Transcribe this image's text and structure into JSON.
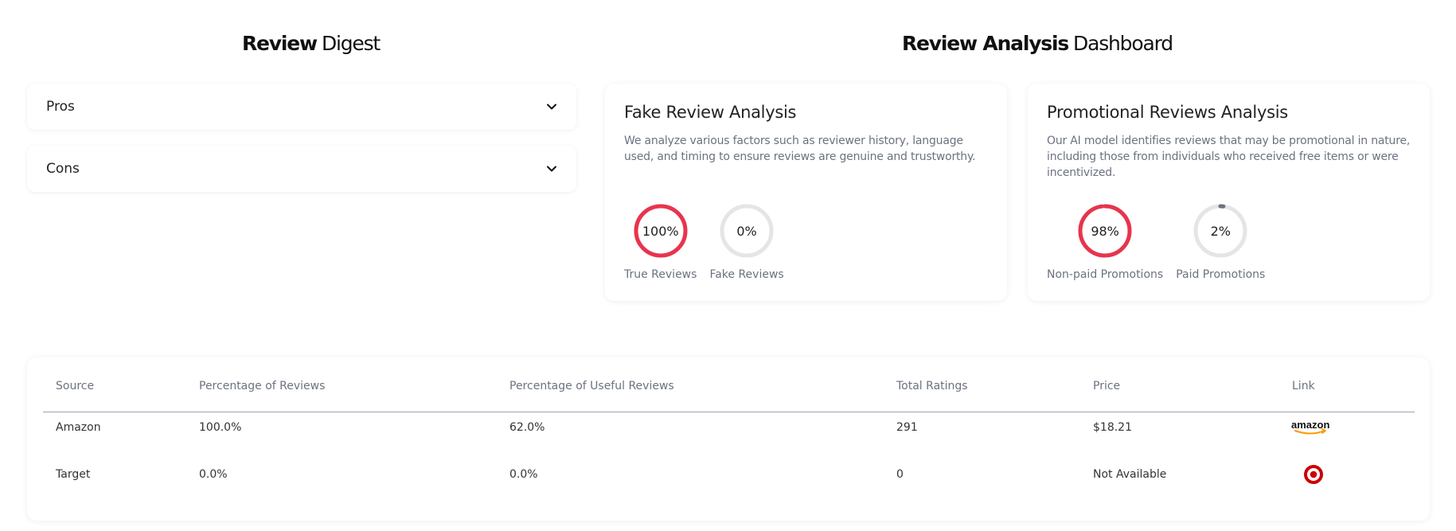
{
  "digest": {
    "title_bold": "Review",
    "title_light": "Digest",
    "sections": [
      {
        "label": "Pros"
      },
      {
        "label": "Cons"
      }
    ]
  },
  "dashboard": {
    "title_bold": "Review Analysis",
    "title_light": "Dashboard",
    "fake": {
      "title": "Fake Review Analysis",
      "description": "We analyze various factors such as reviewer history, language used, and timing to ensure reviews are genuine and trustworthy.",
      "rings": [
        {
          "value": "100%",
          "label": "True Reviews",
          "fraction": 1.0
        },
        {
          "value": "0%",
          "label": "Fake Reviews",
          "fraction": 0.0
        }
      ]
    },
    "promo": {
      "title": "Promotional Reviews Analysis",
      "description": "Our AI model identifies reviews that may be promotional in nature, including those from individuals who received free items or were incentivized.",
      "rings": [
        {
          "value": "98%",
          "label": "Non-paid Promotions",
          "fraction": 0.98
        },
        {
          "value": "2%",
          "label": "Paid Promotions",
          "fraction": 0.02
        }
      ]
    }
  },
  "table": {
    "headers": [
      "Source",
      "Percentage of Reviews",
      "Percentage of Useful Reviews",
      "Total Ratings",
      "Price",
      "Link"
    ],
    "rows": [
      {
        "source": "Amazon",
        "pct_reviews": "100.0%",
        "pct_useful": "62.0%",
        "total_ratings": "291",
        "price": "$18.21",
        "link_logo": "amazon-logo-icon",
        "link_text": "amazon"
      },
      {
        "source": "Target",
        "pct_reviews": "0.0%",
        "pct_useful": "0.0%",
        "total_ratings": "0",
        "price": "Not Available",
        "link_logo": "target-logo-icon"
      }
    ]
  },
  "colors": {
    "accent_red": "#e8344e",
    "ring_track": "#e5e5e5",
    "ring_gray_fill": "#6b7280",
    "amazon_orange": "#ff9900",
    "target_red": "#cc0000"
  }
}
